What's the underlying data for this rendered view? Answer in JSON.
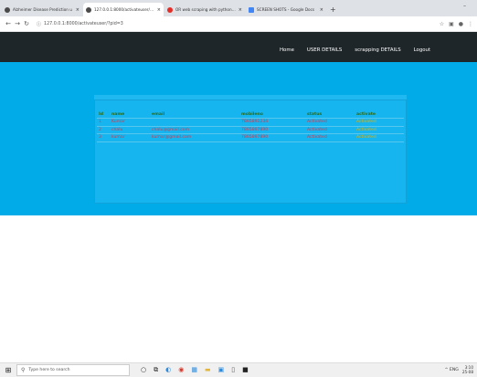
{
  "browser": {
    "tabs": [
      {
        "label": "Alzheimer Disease Prediction u",
        "color": "#4a4a4a"
      },
      {
        "label": "127.0.0.1:8000/activateuser/?pid",
        "color": "#4a4a4a"
      },
      {
        "label": "OR web scraping with python | V",
        "color": "#e52d27"
      },
      {
        "label": "SCREEN SHOTS - Google Docs",
        "color": "#4285f4"
      }
    ],
    "new_tab": "+",
    "minimize": "–",
    "url": "127.0.0.1:8000/activateuser/?pid=3",
    "star": "☆"
  },
  "nav": {
    "items": [
      "Home",
      "USER DETAILS",
      "scrapping DETAILS",
      "Logout"
    ]
  },
  "table": {
    "headers": [
      "Id",
      "name",
      "email",
      "mobileno",
      "status",
      "activate"
    ],
    "rows": [
      [
        "1",
        "Kumar",
        "",
        "7865891234",
        "Activated",
        "Activated"
      ],
      [
        "2",
        "chalu",
        "chalu@gmail.com",
        "7865897890",
        "Activated",
        "Activated"
      ],
      [
        "3",
        "kumar",
        "kumar@gmail.com",
        "7865897890",
        "Activated",
        "Activated"
      ]
    ]
  },
  "taskbar": {
    "search_placeholder": "Type here to search",
    "tray_text": "^ ENG",
    "time": "3:10",
    "date": "25-08"
  },
  "colors": {
    "header": "#1f2629",
    "band": "#00abe8",
    "panel": "#17b5ef",
    "cell_text": "#d6384b",
    "header_text": "#2a6b1e",
    "activate_text": "#e4b100"
  }
}
